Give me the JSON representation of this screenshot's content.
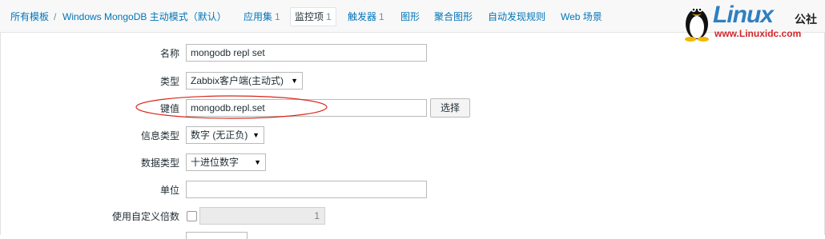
{
  "nav": {
    "breadcrumb_all_templates": "所有模板",
    "separator": "/",
    "breadcrumb_template": "Windows MongoDB 主动模式（默认）",
    "tab_applications": "应用集",
    "tab_applications_count": "1",
    "tab_items": "监控项",
    "tab_items_count": "1",
    "tab_triggers": "触发器",
    "tab_triggers_count": "1",
    "tab_graphs": "图形",
    "tab_screens": "聚合图形",
    "tab_discovery": "自动发现规则",
    "tab_web": "Web 场景"
  },
  "logo": {
    "brand": "Linux",
    "brand_cn": "公社",
    "url": "www.Linuxidc.com"
  },
  "form": {
    "name_label": "名称",
    "name_value": "mongodb repl set",
    "type_label": "类型",
    "type_value": "Zabbix客户端(主动式)",
    "key_label": "键值",
    "key_value": "mongodb.repl.set",
    "select_button": "选择",
    "info_type_label": "信息类型",
    "info_type_value": "数字 (无正负)",
    "data_type_label": "数据类型",
    "data_type_value": "十进位数字",
    "units_label": "单位",
    "units_value": "",
    "multiplier_label": "使用自定义倍数",
    "multiplier_checked": false,
    "multiplier_value": "1"
  },
  "colors": {
    "link": "#0275b8",
    "highlight_ellipse": "#d9261c",
    "logo_blue": "#2f7fc1",
    "logo_red": "#d4242a"
  }
}
